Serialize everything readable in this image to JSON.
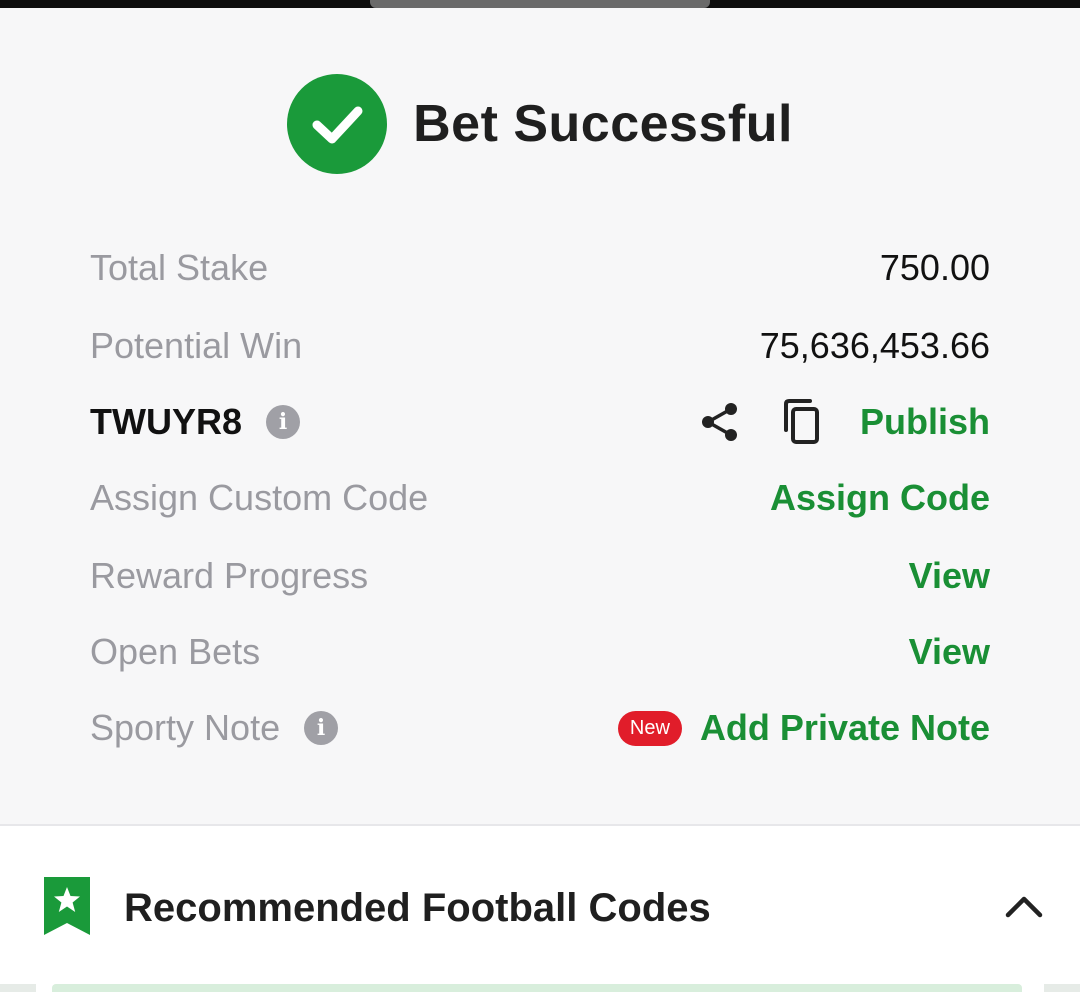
{
  "hero": {
    "title": "Bet Successful",
    "icon": "check-circle-icon"
  },
  "rows": {
    "total_stake": {
      "label": "Total Stake",
      "value": "750.00"
    },
    "potential_win": {
      "label": "Potential Win",
      "value": "75,636,453.66"
    },
    "booking": {
      "code": "TWUYR8",
      "publish": "Publish"
    },
    "assign": {
      "label": "Assign Custom Code",
      "action": "Assign Code"
    },
    "reward": {
      "label": "Reward Progress",
      "action": "View"
    },
    "open_bets": {
      "label": "Open Bets",
      "action": "View"
    },
    "note": {
      "label": "Sporty Note",
      "badge": "New",
      "action": "Add Private Note"
    }
  },
  "recommended": {
    "title": "Recommended Football Codes"
  },
  "colors": {
    "accent_green": "#1a8f35",
    "badge_red": "#e11d2a",
    "label_gray": "#9a9aa0"
  }
}
